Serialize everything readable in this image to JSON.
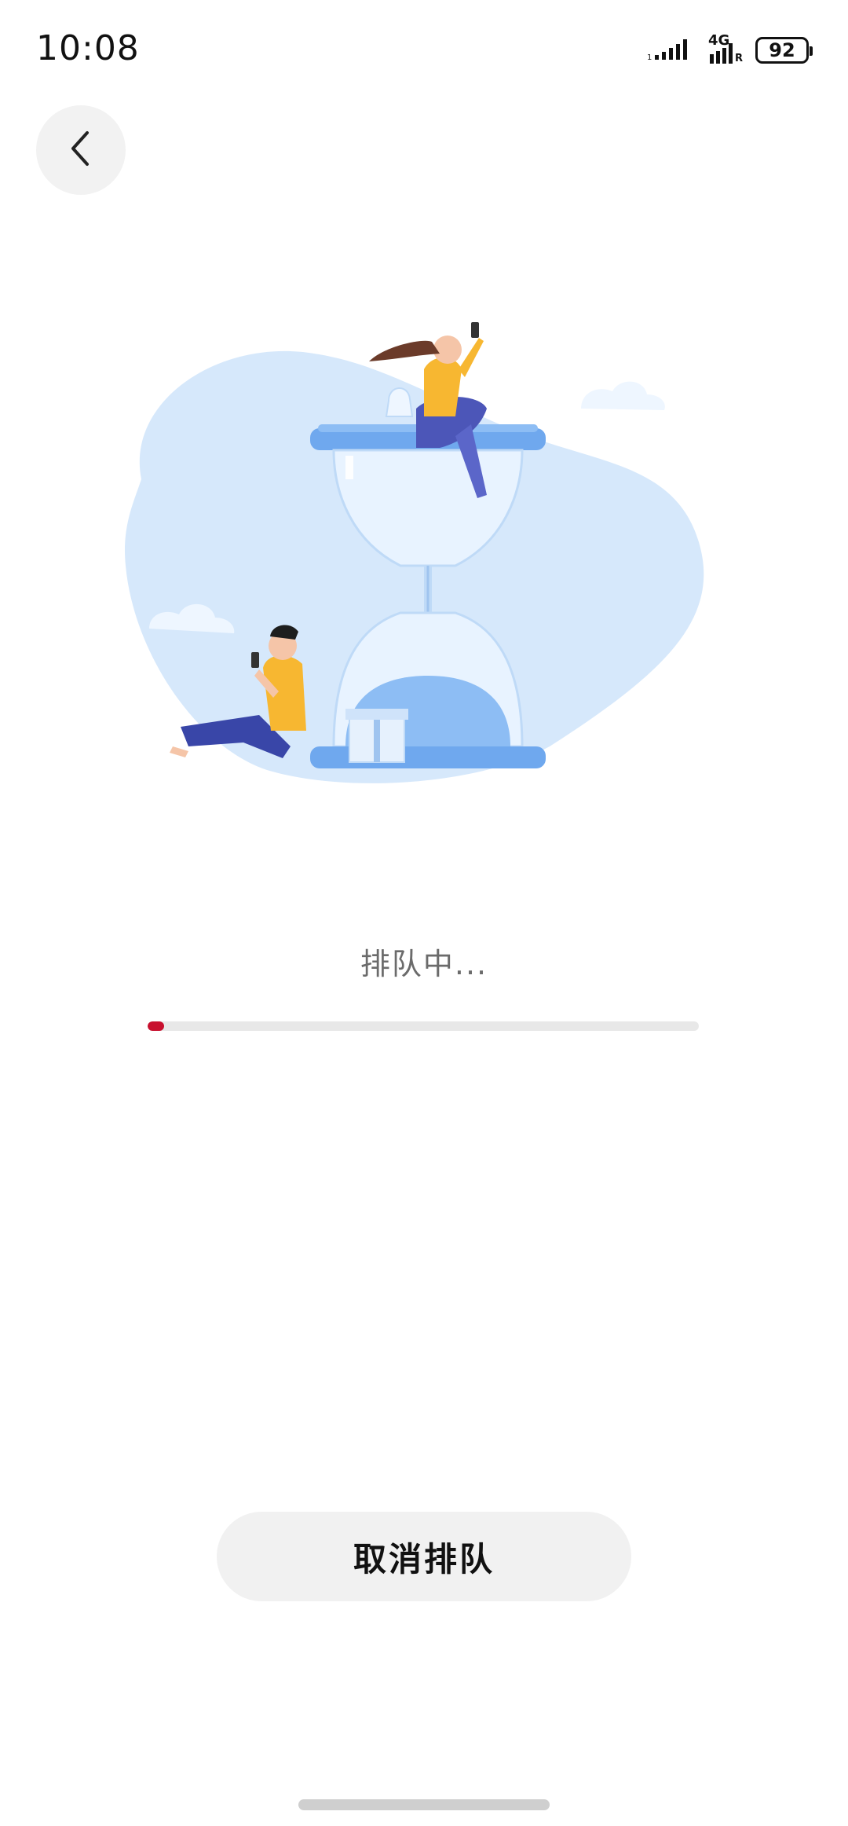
{
  "status_bar": {
    "time": "10:08",
    "network": "4G",
    "network_sub": "R",
    "battery": "92"
  },
  "navigation": {
    "back_icon": "chevron-left-icon"
  },
  "queue": {
    "status_text": "排队中...",
    "progress": 0.03,
    "progress_color": "#c8102e"
  },
  "actions": {
    "cancel_label": "取消排队"
  },
  "illustration": {
    "icon": "hourglass-waiting-illustration"
  }
}
